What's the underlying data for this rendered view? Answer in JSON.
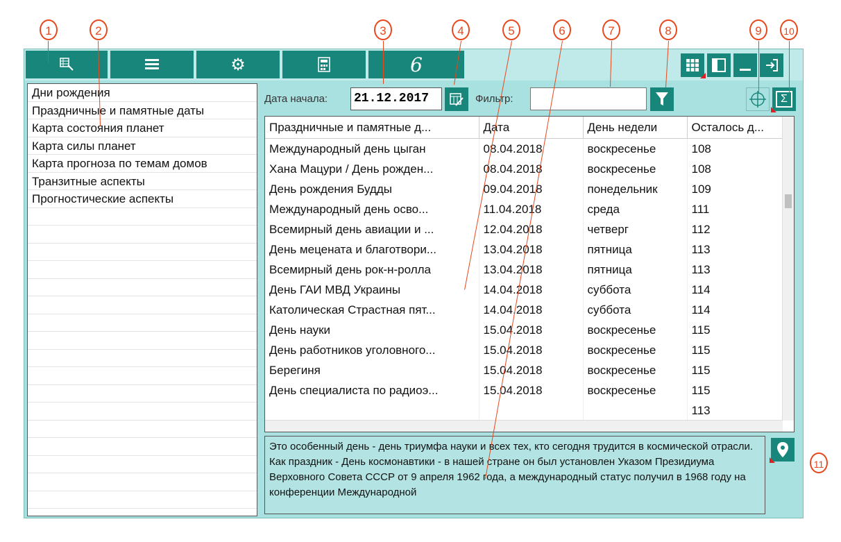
{
  "callouts": [
    "1",
    "2",
    "3",
    "4",
    "5",
    "6",
    "7",
    "8",
    "9",
    "10",
    "11"
  ],
  "toolbar": {
    "tabs": [
      {
        "icon": "chart-table-icon"
      },
      {
        "icon": "list-icon"
      },
      {
        "icon": "gear-icon"
      },
      {
        "icon": "calculator-icon"
      },
      {
        "icon": "signature-icon"
      }
    ],
    "right_buttons": [
      {
        "icon": "grid-view-icon"
      },
      {
        "icon": "panel-layout-icon"
      },
      {
        "icon": "minimize-icon"
      },
      {
        "icon": "exit-icon"
      }
    ]
  },
  "sidebar": {
    "items": [
      "Дни рождения",
      "Праздничные и памятные даты",
      "Карта состояния планет",
      "Карта силы планет",
      "Карта прогноза по темам домов",
      "Транзитные аспекты",
      "Прогностические аспекты"
    ]
  },
  "controls": {
    "date_label": "Дата начала:",
    "date_value": "21.12.2017",
    "filter_label": "Фильтр:",
    "filter_value": ""
  },
  "table": {
    "columns": [
      "Праздничные и памятные д...",
      "Дата",
      "День недели",
      "Осталось д..."
    ],
    "rows": [
      [
        "Международный день цыган",
        "08.04.2018",
        "воскресенье",
        "108"
      ],
      [
        "Хана Мацури / День рожден...",
        "08.04.2018",
        "воскресенье",
        "108"
      ],
      [
        "День рождения Будды",
        "09.04.2018",
        "понедельник",
        "109"
      ],
      [
        "Международный день осво...",
        "11.04.2018",
        "среда",
        "111"
      ],
      [
        "Всемирный день авиации и ...",
        "12.04.2018",
        "четверг",
        "112"
      ],
      [
        "День мецената и благотвори...",
        "13.04.2018",
        "пятница",
        "113"
      ],
      [
        "Всемирный день рок-н-ролла",
        "13.04.2018",
        "пятница",
        "113"
      ],
      [
        "День ГАИ МВД Украины",
        "14.04.2018",
        "суббота",
        "114"
      ],
      [
        "Католическая Страстная пят...",
        "14.04.2018",
        "суббота",
        "114"
      ],
      [
        "День науки",
        "15.04.2018",
        "воскресенье",
        "115"
      ],
      [
        "День работников уголовного...",
        "15.04.2018",
        "воскресенье",
        "115"
      ],
      [
        "Берегиня",
        "15.04.2018",
        "воскресенье",
        "115"
      ],
      [
        "День специалиста по радиоэ...",
        "15.04.2018",
        "воскресенье",
        "115"
      ],
      [
        "",
        "",
        "",
        "113"
      ]
    ]
  },
  "description": "Это особенный день - день триумфа науки и всех тех, кто сегодня трудится в космической отрасли. Как праздник - День космонавтики - в нашей стране он был установлен Указом Президиума Верховного Совета СССР от 9 апреля 1962 года, а международный статус получил в 1968 году на конференции Международной",
  "colors": {
    "accent": "#18867b",
    "panel": "#a9e1e0",
    "callout": "#e8471c"
  }
}
